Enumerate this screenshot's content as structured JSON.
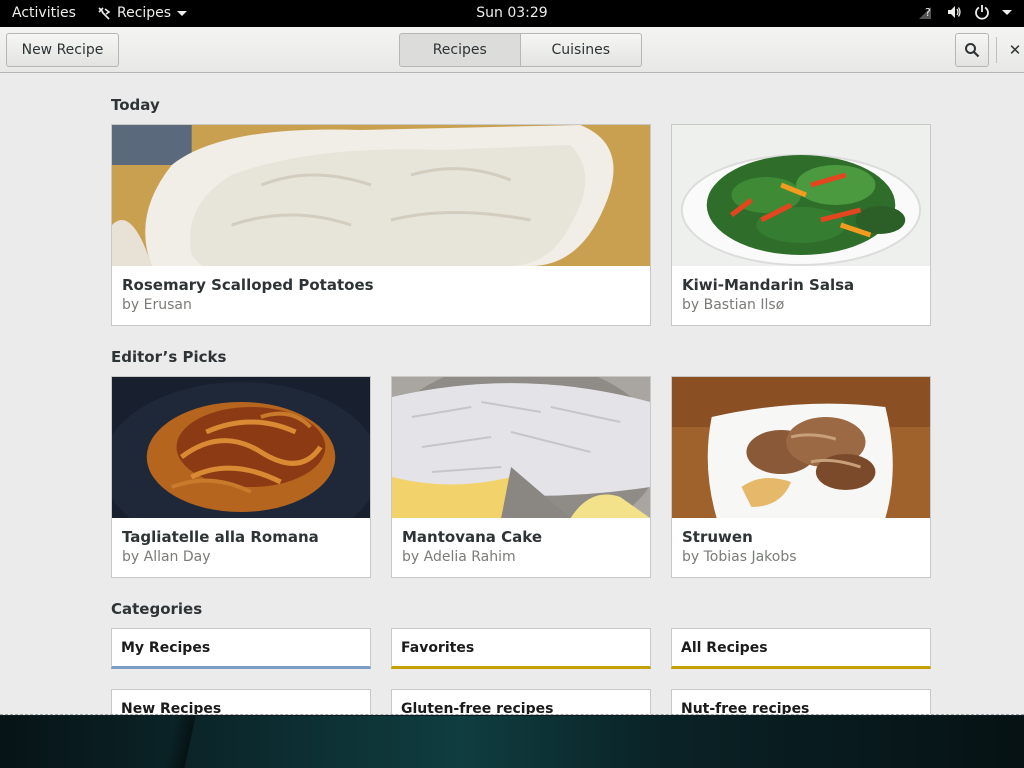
{
  "topbar": {
    "activities": "Activities",
    "app_name": "Recipes",
    "clock": "Sun 03:29",
    "status_icons": [
      "network-unknown-icon",
      "volume-icon",
      "power-icon"
    ]
  },
  "headerbar": {
    "new_recipe": "New Recipe",
    "tabs": [
      {
        "label": "Recipes",
        "active": true
      },
      {
        "label": "Cuisines",
        "active": false
      }
    ],
    "search_icon": "search-icon",
    "close_icon": "close-icon"
  },
  "sections": {
    "today": "Today",
    "editors_picks": "Editor’s Picks",
    "categories": "Categories"
  },
  "today": [
    {
      "title": "Rosemary Scalloped Potatoes",
      "author": "by Erusan"
    },
    {
      "title": "Kiwi-Mandarin Salsa",
      "author": "by Bastian Ilsø"
    }
  ],
  "picks": [
    {
      "title": "Tagliatelle alla Romana",
      "author": "by Allan Day"
    },
    {
      "title": "Mantovana Cake",
      "author": "by Adelia Rahim"
    },
    {
      "title": "Struwen",
      "author": "by Tobias Jakobs"
    }
  ],
  "categories": [
    {
      "label": "My Recipes",
      "accent": "#7d9ec4"
    },
    {
      "label": "Favorites",
      "accent": "#c4a000"
    },
    {
      "label": "All Recipes",
      "accent": "#c4a000"
    },
    {
      "label": "New Recipes",
      "accent": "#c4a000"
    },
    {
      "label": "Gluten-free recipes",
      "accent": "#c4a000"
    },
    {
      "label": "Nut-free recipes",
      "accent": "#c4a000"
    }
  ]
}
